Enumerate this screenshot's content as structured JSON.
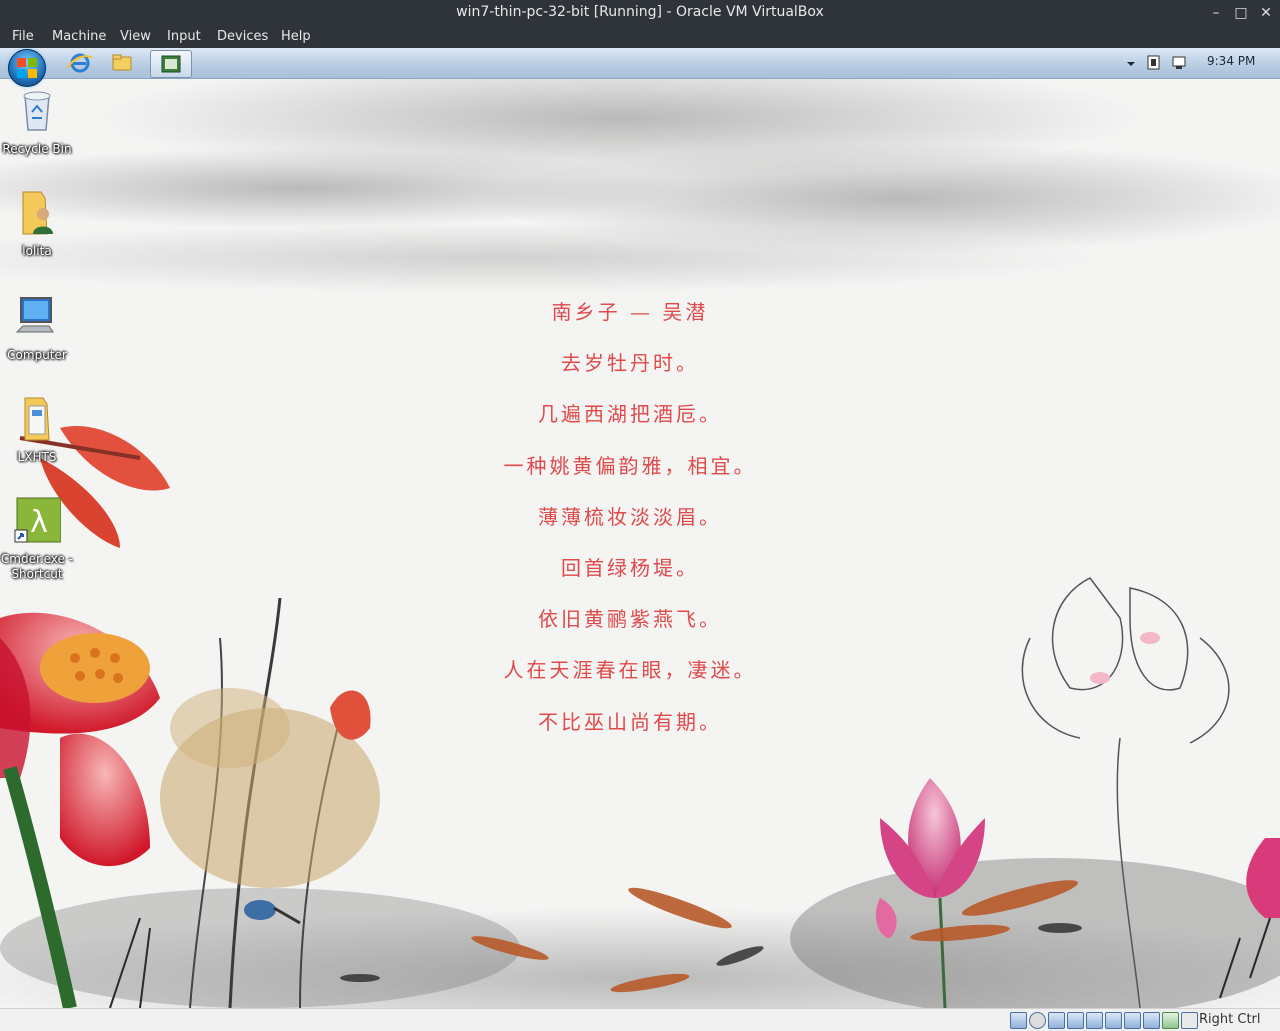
{
  "window": {
    "title": "win7-thin-pc-32-bit [Running] - Oracle VM VirtualBox",
    "minimize_glyph": "–",
    "maximize_glyph": "□",
    "close_glyph": "✕"
  },
  "menubar": {
    "items": [
      "File",
      "Machine",
      "View",
      "Input",
      "Devices",
      "Help"
    ]
  },
  "taskbar": {
    "pinned": [
      "internet-explorer-icon",
      "windows-explorer-icon",
      "virtualbox-guest-app-icon"
    ],
    "clock": "9:34 PM",
    "tray_icons": [
      "show-hidden-icons-chevron",
      "action-center-icon",
      "network-icon"
    ]
  },
  "desktop": {
    "icons": [
      {
        "label": "Recycle Bin",
        "icon": "recycle-bin-icon"
      },
      {
        "label": "lolita",
        "icon": "user-folder-icon"
      },
      {
        "label": "Computer",
        "icon": "computer-icon"
      },
      {
        "label": "LXHTS",
        "icon": "folder-icon"
      },
      {
        "label": "Cmder.exe -",
        "label2": "Shortcut",
        "icon": "cmder-shortcut-icon"
      }
    ]
  },
  "poem": {
    "title": "南乡子 — 吴潜",
    "lines": [
      "去岁牡丹时。",
      "几遍西湖把酒卮。",
      "一种姚黄偏韵雅，相宜。",
      "薄薄梳妆淡淡眉。",
      "回首绿杨堤。",
      "依旧黄鹂紫燕飞。",
      "人在天涯春在眼，凄迷。",
      "不比巫山尚有期。"
    ]
  },
  "statusbar": {
    "host_key": "Right Ctrl",
    "icons": [
      "hard-disk-icon",
      "optical-drive-icon",
      "audio-icon",
      "network-adapter-icon",
      "usb-icon",
      "shared-folders-icon",
      "display-icon",
      "video-capture-icon",
      "cpu-icon",
      "mouse-integration-icon",
      "keyboard-capture-icon"
    ]
  },
  "colors": {
    "poem_text": "#e04a4a",
    "host_chrome": "#2f343b",
    "taskbar": "#b9cde3"
  }
}
